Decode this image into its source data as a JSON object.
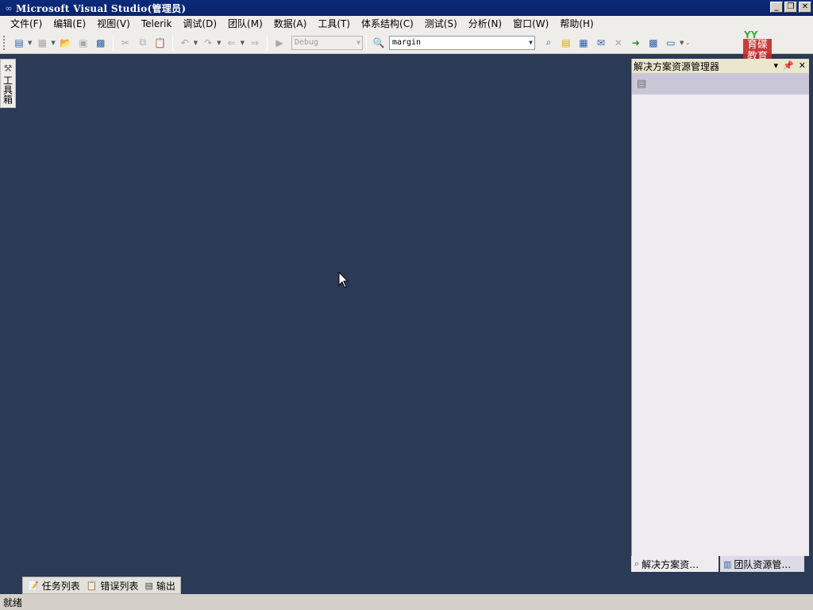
{
  "window": {
    "title": "Microsoft Visual Studio(管理员)",
    "minimize": "_",
    "restore": "❐",
    "close": "✕"
  },
  "menu": [
    "文件(F)",
    "编辑(E)",
    "视图(V)",
    "Telerik",
    "调试(D)",
    "团队(M)",
    "数据(A)",
    "工具(T)",
    "体系结构(C)",
    "测试(S)",
    "分析(N)",
    "窗口(W)",
    "帮助(H)"
  ],
  "toolbar": {
    "config_combo": "Debug",
    "find_combo": "margin"
  },
  "watermark": {
    "top": "YY",
    "text": "育碟 教育"
  },
  "toolbox": {
    "label": "工具箱"
  },
  "solution_explorer": {
    "title": "解决方案资源管理器",
    "tabs": [
      "解决方案资…",
      "团队资源管…"
    ]
  },
  "bottom_tabs": [
    "任务列表",
    "错误列表",
    "输出"
  ],
  "status": "就绪"
}
